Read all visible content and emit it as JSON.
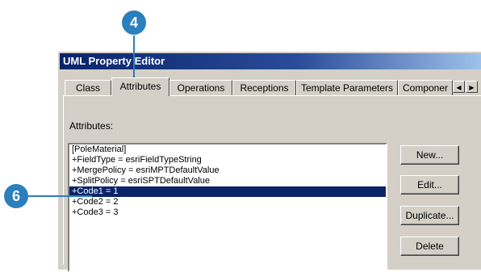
{
  "window": {
    "title": "UML Property Editor",
    "close_glyph": "✕"
  },
  "tabs": [
    {
      "label": "Class"
    },
    {
      "label": "Attributes",
      "active": true
    },
    {
      "label": "Operations"
    },
    {
      "label": "Receptions"
    },
    {
      "label": "Template Parameters"
    },
    {
      "label": "Componer"
    }
  ],
  "tab_scroll": {
    "left": "◀",
    "right": "▶"
  },
  "attributes": {
    "label": "Attributes:",
    "items": [
      "[PoleMaterial]",
      "+FieldType = esriFieldTypeString",
      "+MergePolicy = esriMPTDefaultValue",
      "+SplitPolicy = esriSPTDefaultValue",
      "+Code1 = 1",
      "+Code2 = 2",
      "+Code3 = 3"
    ],
    "selected_index": 4
  },
  "buttons": {
    "new": "New...",
    "edit": "Edit...",
    "duplicate": "Duplicate...",
    "delete": "Delete"
  },
  "callouts": {
    "step_4": "4",
    "step_6": "6"
  },
  "colors": {
    "title_bar": "#0a246a",
    "selection": "#0a246a",
    "callout": "#2a7fbc",
    "dialog_face": "#d4d0c8"
  }
}
